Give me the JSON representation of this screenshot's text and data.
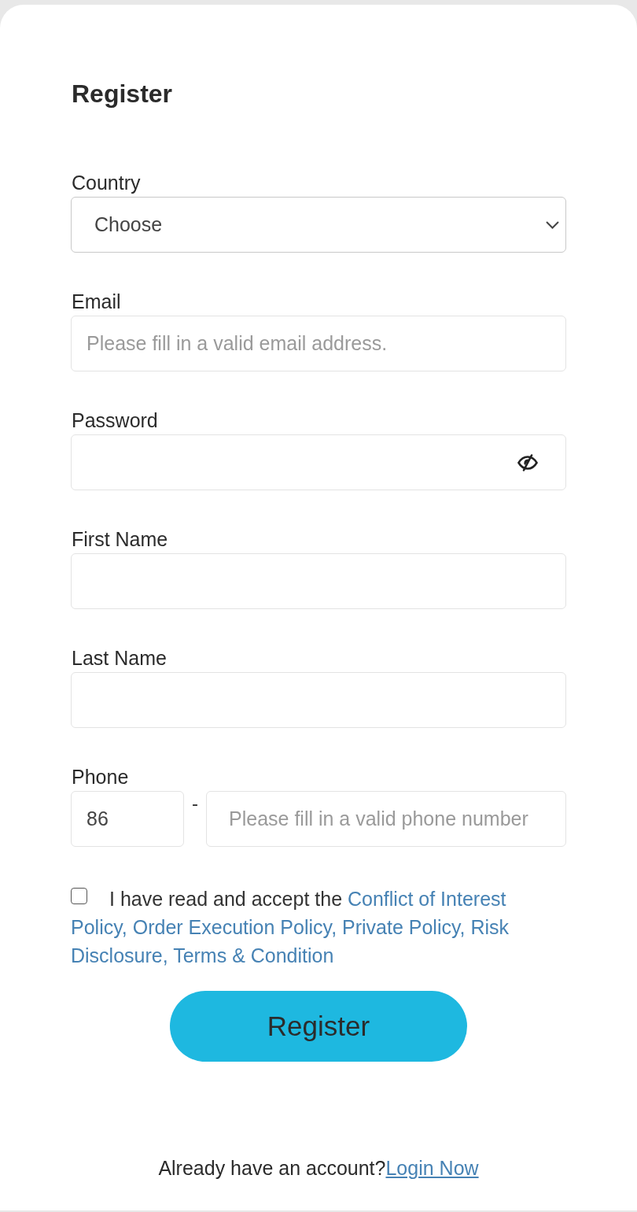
{
  "title": "Register",
  "fields": [
    {
      "kind": "select",
      "label": "Country",
      "value": "Choose"
    },
    {
      "kind": "text",
      "label": "Email",
      "placeholder": "Please fill in a valid email address."
    },
    {
      "kind": "password",
      "label": "Password"
    },
    {
      "kind": "text",
      "label": "First Name"
    },
    {
      "kind": "text",
      "label": "Last Name"
    },
    {
      "kind": "phone",
      "label": "Phone",
      "code": "86",
      "separator": "-",
      "placeholder": "Please fill in a valid phone number"
    }
  ],
  "agreement": {
    "checked": false,
    "text": "I have read and accept the",
    "links": [
      "Conflict of Interest",
      "Policy, Order Execution Policy, Private Policy, Risk",
      "Disclosure, Terms & Condition"
    ]
  },
  "submit": "Register",
  "footer": {
    "text": "Already have an account?",
    "link": "Login Now"
  }
}
